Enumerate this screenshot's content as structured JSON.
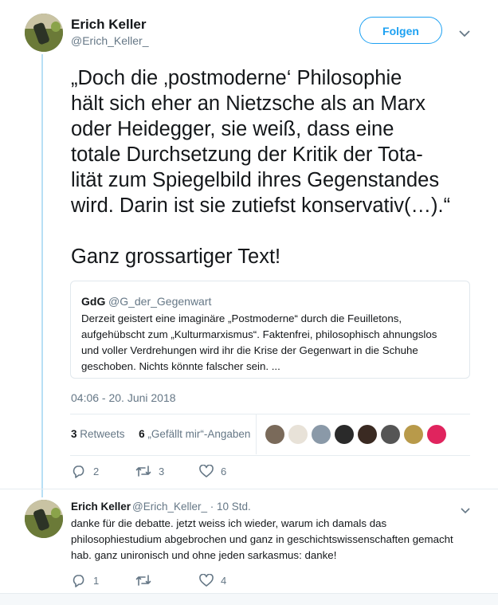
{
  "main_tweet": {
    "author_name": "Erich Keller",
    "author_handle": "@Erich_Keller_",
    "follow_label": "Folgen",
    "text": "„Doch die ‚postmoderne‘ Philosophie\nhält sich eher an Nietzsche als an Marx\noder Heidegger, sie weiß, dass eine\ntotale Durchsetzung der Kritik der Tota-\nlität zum Spiegelbild ihres Gegenstandes\nwird. Darin ist sie zutiefst konservativ(…).“\n\nGanz grossartiger Text!",
    "quote": {
      "name": "GdG",
      "handle": "@G_der_Gegenwart",
      "text": "Derzeit geistert eine imaginäre „Postmoderne“ durch die Feuilletons,\naufgehübscht zum „Kulturmarxismus“. Faktenfrei, philosophisch ahnungslos\nund voller Verdrehungen wird ihr die Krise der Gegenwart in die Schuhe\ngeschoben. Nichts könnte falscher sein. ..."
    },
    "timestamp": "04:06 - 20. Juni 2018",
    "retweets_count": "3",
    "retweets_label": "Retweets",
    "likes_count": "6",
    "likes_label": "„Gefällt mir“-Angaben",
    "liker_avatar_colors": [
      "#7a6a5a",
      "#e8e2d8",
      "#8a99a8",
      "#2a2a2a",
      "#3a2a22",
      "#555555",
      "#b89a4a",
      "#e0245e"
    ],
    "actions": {
      "reply_count": "2",
      "retweet_count": "3",
      "like_count": "6"
    }
  },
  "reply_tweet": {
    "author_name": "Erich Keller",
    "author_handle": "@Erich_Keller_",
    "time": "· 10 Std.",
    "text": "danke für die debatte. jetzt weiss ich wieder, warum ich damals das\nphilosophiestudium abgebrochen und ganz in geschichtswissenschaften gemacht\nhab. ganz unironisch und ohne jeden sarkasmus: danke!",
    "actions": {
      "reply_count": "1",
      "retweet_count": "",
      "like_count": "4"
    }
  },
  "colors": {
    "accent": "#1da1f2",
    "secondary_text": "#657786",
    "thread_line": "#b8dff5"
  }
}
